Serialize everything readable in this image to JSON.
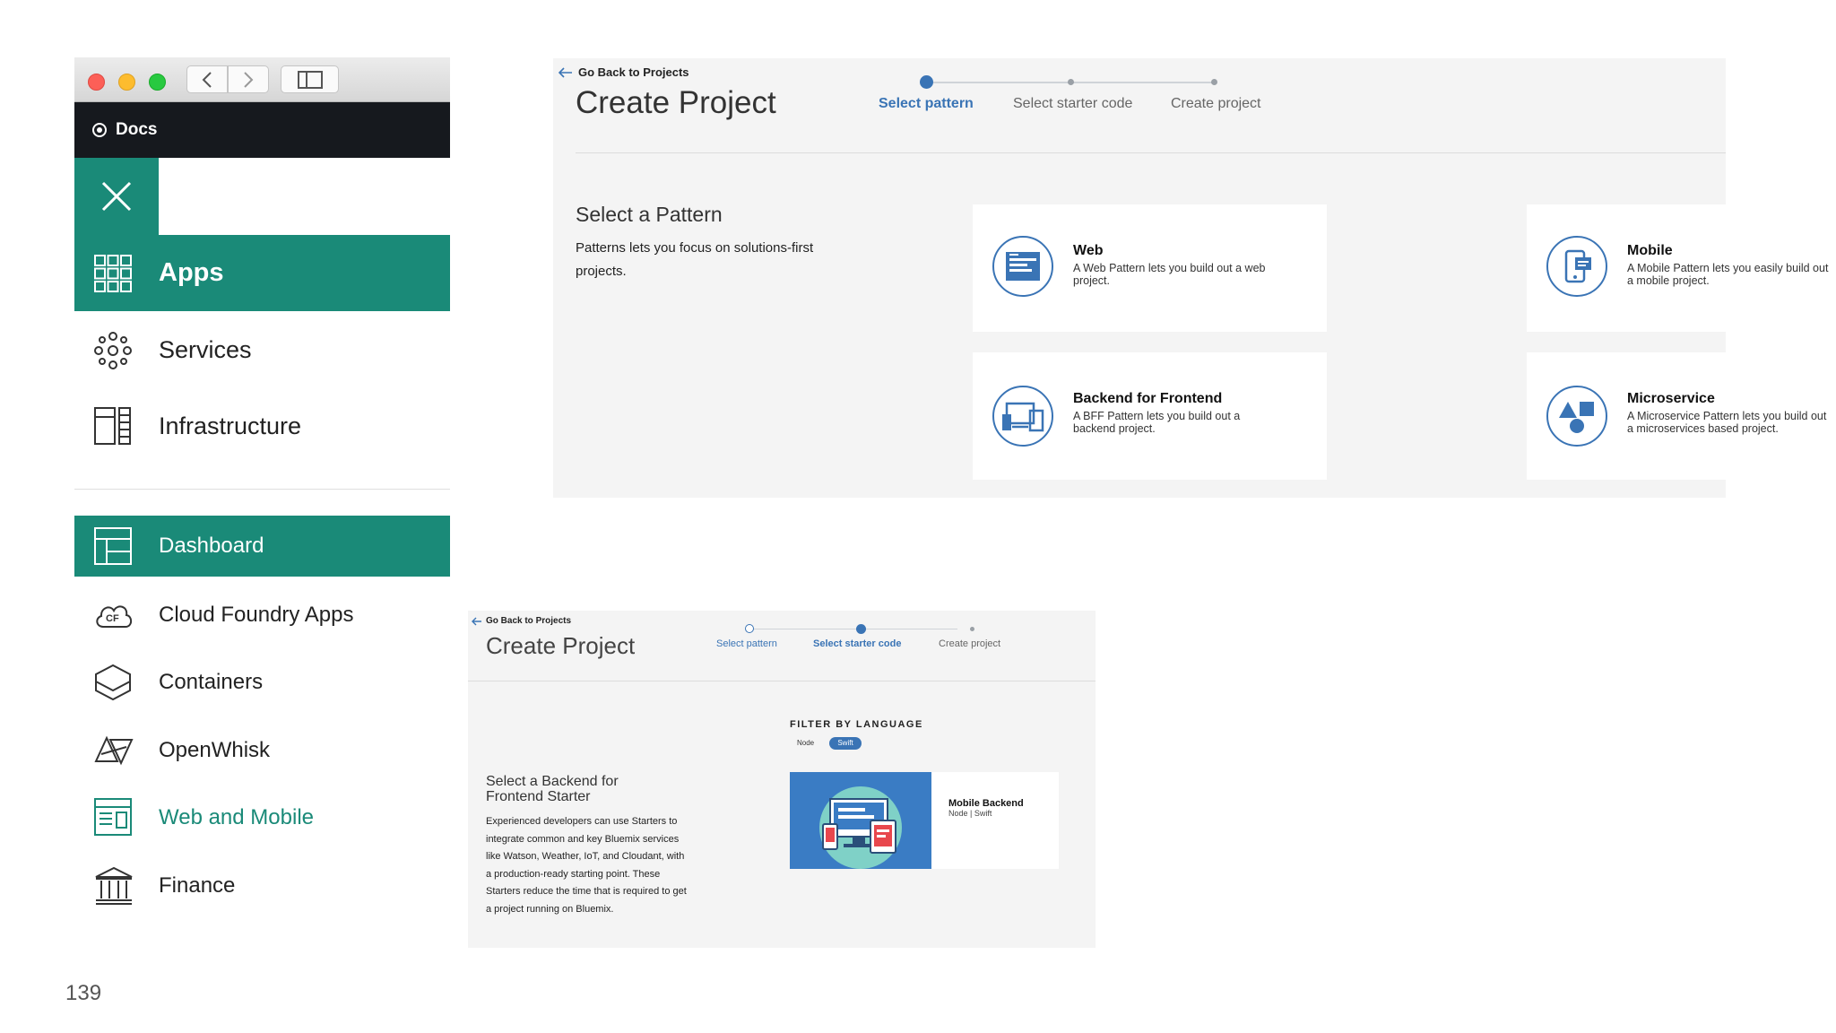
{
  "sidebar": {
    "docs_label": "Docs",
    "items": [
      {
        "label": "Apps",
        "icon": "grid-icon"
      },
      {
        "label": "Services",
        "icon": "services-icon"
      },
      {
        "label": "Infrastructure",
        "icon": "infrastructure-icon"
      }
    ],
    "sub_items": [
      {
        "label": "Dashboard",
        "icon": "dashboard-icon"
      },
      {
        "label": "Cloud Foundry Apps",
        "icon": "cloud-foundry-icon",
        "icon_text": "CF"
      },
      {
        "label": "Containers",
        "icon": "containers-icon"
      },
      {
        "label": "OpenWhisk",
        "icon": "openwhisk-icon"
      },
      {
        "label": "Web and Mobile",
        "icon": "web-mobile-icon"
      },
      {
        "label": "Finance",
        "icon": "finance-icon"
      }
    ]
  },
  "page_number": "139",
  "panel_top": {
    "back_label": "Go Back to Projects",
    "title": "Create Project",
    "steps": [
      "Select pattern",
      "Select starter code",
      "Create project"
    ],
    "active_step": 0,
    "section_title": "Select a Pattern",
    "section_desc": "Patterns lets you focus on solutions-first projects.",
    "cards": [
      {
        "title": "Web",
        "desc": "A Web Pattern lets you build out a web project.",
        "icon": "web-pattern-icon"
      },
      {
        "title": "Mobile",
        "desc": "A Mobile Pattern lets you easily build out a mobile project.",
        "icon": "mobile-pattern-icon"
      },
      {
        "title": "Backend for Frontend",
        "desc": "A BFF Pattern lets you build out a backend project.",
        "icon": "bff-pattern-icon"
      },
      {
        "title": "Microservice",
        "desc": "A Microservice Pattern lets you build out a microservices based project.",
        "icon": "microservice-pattern-icon"
      }
    ]
  },
  "panel_bottom": {
    "back_label": "Go Back to Projects",
    "title": "Create Project",
    "steps": [
      "Select pattern",
      "Select starter code",
      "Create project"
    ],
    "active_step": 1,
    "section_title": "Select a Backend for Frontend Starter",
    "section_desc": "Experienced developers can use Starters to integrate common and key Bluemix services like Watson, Weather, IoT, and Cloudant, with a production-ready starting point. These Starters reduce the time that is required to get a project running on Bluemix.",
    "filter_label": "FILTER BY LANGUAGE",
    "filters": [
      "Node",
      "Swift"
    ],
    "selected_filter": "Swift",
    "starter_title": "Mobile Backend",
    "starter_sub": "Node | Swift"
  },
  "colors": {
    "accent_green": "#1a8a78",
    "accent_blue": "#3a74b5",
    "docs_bar": "#16191e",
    "panel_bg": "#f4f4f4"
  }
}
